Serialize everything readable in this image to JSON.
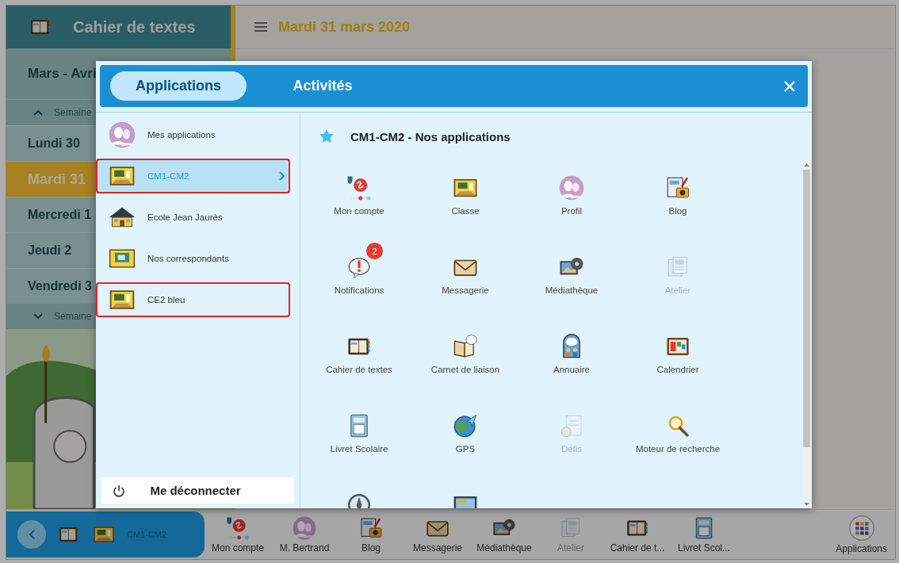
{
  "sidebar": {
    "title": "Cahier de textes",
    "period": "Mars - Avri",
    "week_up": "Semaine",
    "days": [
      {
        "label": "Lundi 30",
        "selected": false
      },
      {
        "label": "Mardi 31",
        "selected": true
      },
      {
        "label": "Mercredi 1",
        "selected": false
      },
      {
        "label": "Jeudi 2",
        "selected": false
      },
      {
        "label": "Vendredi 3",
        "selected": false
      }
    ],
    "week_down": "Semaine"
  },
  "main": {
    "date": "Mardi 31 mars 2020"
  },
  "modal": {
    "tabs": [
      {
        "label": "Applications",
        "selected": true
      },
      {
        "label": "Activités",
        "selected": false
      }
    ],
    "places": [
      {
        "label": "Mes applications",
        "kind": "profile",
        "selected": false,
        "outlined": false
      },
      {
        "label": "CM1-CM2",
        "kind": "classroom",
        "selected": true,
        "outlined": true
      },
      {
        "label": "Ecole Jean Jaurès",
        "kind": "school",
        "selected": false,
        "outlined": false
      },
      {
        "label": "Nos correspondants",
        "kind": "mapboard",
        "selected": false,
        "outlined": false
      },
      {
        "label": "CE2 bleu",
        "kind": "classroom",
        "selected": false,
        "outlined": true
      }
    ],
    "logout": "Me déconnecter",
    "apps_title": "CM1-CM2 - Nos applications",
    "apps": [
      {
        "label": "Mon compte",
        "kind": "account",
        "disabled": false
      },
      {
        "label": "Classe",
        "kind": "classroom",
        "disabled": false
      },
      {
        "label": "Profil",
        "kind": "profile",
        "disabled": false
      },
      {
        "label": "Blog",
        "kind": "blog",
        "disabled": false
      },
      {
        "label": "Notifications",
        "kind": "notifications",
        "disabled": false,
        "badge": "2"
      },
      {
        "label": "Messagerie",
        "kind": "mail",
        "disabled": false
      },
      {
        "label": "Médiathèque",
        "kind": "media",
        "disabled": false
      },
      {
        "label": "Atelier",
        "kind": "workshop",
        "disabled": true
      },
      {
        "label": "Cahier de textes",
        "kind": "homework",
        "disabled": false
      },
      {
        "label": "Carnet de liaison",
        "kind": "liaison",
        "disabled": false
      },
      {
        "label": "Annuaire",
        "kind": "directory",
        "disabled": false
      },
      {
        "label": "Calendrier",
        "kind": "calendar",
        "disabled": false
      },
      {
        "label": "Livret Scolaire",
        "kind": "report",
        "disabled": false
      },
      {
        "label": "GPS",
        "kind": "gps",
        "disabled": false
      },
      {
        "label": "Défis",
        "kind": "challenges",
        "disabled": true
      },
      {
        "label": "Moteur de recherche",
        "kind": "search",
        "disabled": false
      },
      {
        "kind": "compass",
        "disabled": false
      },
      {
        "kind": "screen",
        "disabled": false
      }
    ]
  },
  "dock": {
    "class_label": "CM1-CM2",
    "items": [
      {
        "label": "Mon compte",
        "kind": "account",
        "disabled": false
      },
      {
        "label": "M. Bertrand",
        "kind": "profile",
        "disabled": false
      },
      {
        "label": "Blog",
        "kind": "blog",
        "disabled": false
      },
      {
        "label": "Messagerie",
        "kind": "mail",
        "disabled": false
      },
      {
        "label": "Médiathèque",
        "kind": "media",
        "disabled": false
      },
      {
        "label": "Atelier",
        "kind": "workshop",
        "disabled": true
      },
      {
        "label": "Cahier de t...",
        "kind": "homework",
        "disabled": false
      },
      {
        "label": "Livret Scol...",
        "kind": "report",
        "disabled": false
      }
    ],
    "apps_label": "Applications"
  }
}
